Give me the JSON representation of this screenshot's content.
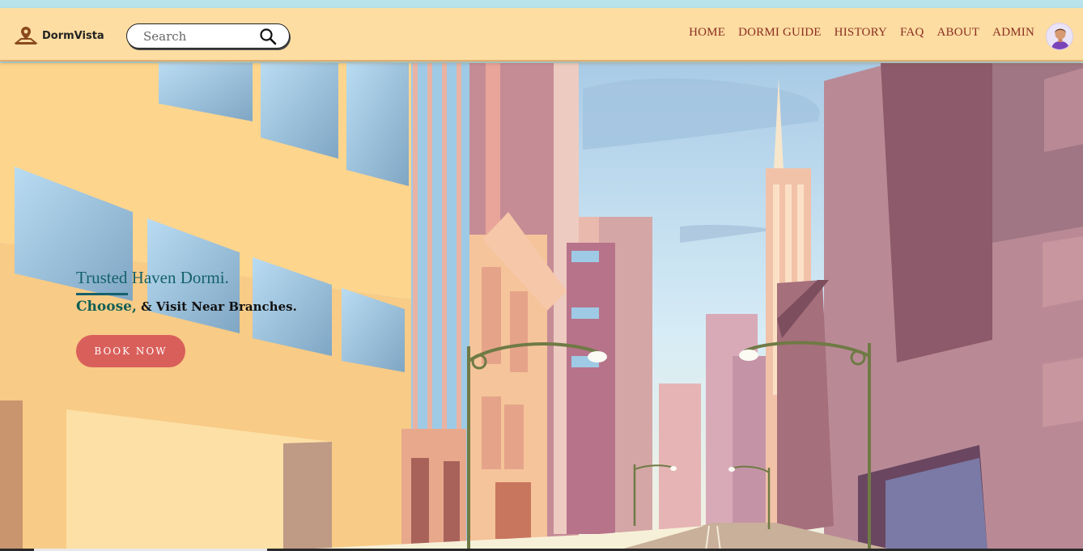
{
  "brand": {
    "name": "DormVista",
    "logo_icon": "map-pin-icon"
  },
  "search": {
    "placeholder": "Search",
    "value": "",
    "icon": "search-icon"
  },
  "nav": {
    "items": [
      {
        "label": "HOME"
      },
      {
        "label": "DORMI GUIDE"
      },
      {
        "label": "HISTORY"
      },
      {
        "label": "FAQ"
      },
      {
        "label": "ABOUT"
      },
      {
        "label": "ADMIN"
      }
    ],
    "avatar_icon": "user-avatar-icon"
  },
  "hero": {
    "tagline": "Trusted Haven Dormi.",
    "subline_accent": "Choose,",
    "subline_rest": "& Visit Near Branches.",
    "cta_label": "BOOK NOW"
  },
  "colors": {
    "navbar_bg": "#fddda2",
    "nav_link": "#8b2e21",
    "tagline": "#14616b",
    "cta_bg": "#d95f5b",
    "sky": "#c4e4f4"
  }
}
